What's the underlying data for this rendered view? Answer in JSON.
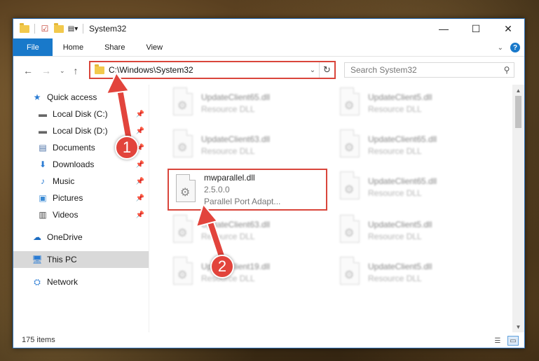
{
  "window": {
    "title": "System32",
    "controls": {
      "minimize": "—",
      "maximize": "☐",
      "close": "✕"
    }
  },
  "ribbon": {
    "tabs": [
      {
        "label": "File",
        "active": true
      },
      {
        "label": "Home"
      },
      {
        "label": "Share"
      },
      {
        "label": "View"
      }
    ],
    "collapse_icon": "chevron-down-icon",
    "help": "?"
  },
  "address": {
    "path": "C:\\Windows\\System32",
    "dropdown": "⌄",
    "refresh": "↻"
  },
  "search": {
    "placeholder": "Search System32"
  },
  "nav": {
    "back": "←",
    "forward": "→",
    "recent": "⌄",
    "up": "↑"
  },
  "sidebar": {
    "items": [
      {
        "label": "Quick access",
        "icon": "star-icon",
        "level": 1
      },
      {
        "label": "Local Disk (C:)",
        "icon": "drive-icon",
        "level": 2,
        "pinned": true
      },
      {
        "label": "Local Disk (D:)",
        "icon": "drive-icon",
        "level": 2,
        "pinned": true
      },
      {
        "label": "Documents",
        "icon": "document-icon",
        "level": 2,
        "pinned": true
      },
      {
        "label": "Downloads",
        "icon": "download-icon",
        "level": 2,
        "pinned": true
      },
      {
        "label": "Music",
        "icon": "music-icon",
        "level": 2,
        "pinned": true
      },
      {
        "label": "Pictures",
        "icon": "picture-icon",
        "level": 2,
        "pinned": true
      },
      {
        "label": "Videos",
        "icon": "video-icon",
        "level": 2,
        "pinned": true
      },
      {
        "label": "OneDrive",
        "icon": "cloud-icon",
        "level": 1
      },
      {
        "label": "This PC",
        "icon": "computer-icon",
        "level": 1,
        "selected": true
      },
      {
        "label": "Network",
        "icon": "network-icon",
        "level": 1
      }
    ]
  },
  "files": {
    "highlighted": {
      "name": "mwparallel.dll",
      "version": "2.5.0.0",
      "description": "Parallel Port Adapt..."
    },
    "col1": [
      {
        "name": "UpdateClient65.dll",
        "desc": "Resource DLL"
      },
      {
        "name": "UpdateClient63.dll",
        "desc": "Resource DLL"
      },
      {
        "name": "UpdateClient63.dll",
        "desc": "Resource DLL"
      },
      {
        "name": "UpdateClient19.dll",
        "desc": "Resource DLL"
      }
    ],
    "col2": [
      {
        "name": "UpdateClient5.dll",
        "desc": "Resource DLL"
      },
      {
        "name": "UpdateClient65.dll",
        "desc": "Resource DLL"
      },
      {
        "name": "UpdateClient65.dll",
        "desc": "Resource DLL"
      },
      {
        "name": "UpdateClient5.dll",
        "desc": "Resource DLL"
      },
      {
        "name": "UpdateClient5.dll",
        "desc": "Resource DLL"
      }
    ]
  },
  "annotations": {
    "step1": "1",
    "step2": "2",
    "color": "#e2443c"
  },
  "status": {
    "count": "175 items"
  }
}
